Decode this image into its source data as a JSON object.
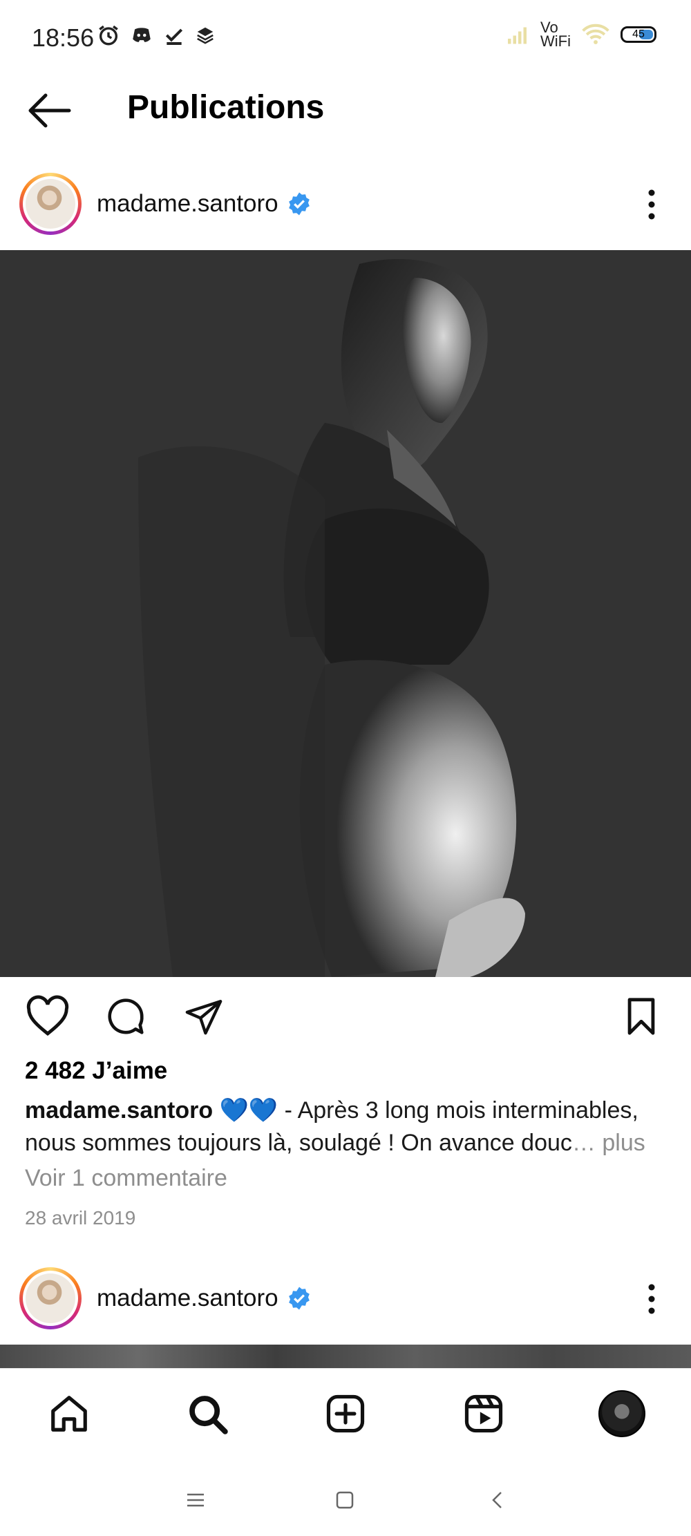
{
  "status_bar": {
    "time": "18:56",
    "icons": [
      "alarm-icon",
      "discord-icon",
      "check-icon",
      "layers-icon"
    ],
    "right_icons": [
      "signal-icon",
      "wifi-icon",
      "battery-icon"
    ],
    "vowifi_top": "Vo",
    "vowifi_bottom": "WiFi",
    "battery": "45"
  },
  "header": {
    "title": "Publications"
  },
  "post": {
    "username": "madame.santoro",
    "verified": true,
    "likes": "2 482 J’aime",
    "caption_user": "madame.santoro",
    "caption_emoji": "💙💙",
    "caption_text": "- Après 3 long mois interminables, nous sommes toujours là, soulagé ! On avance douc",
    "caption_ellipsis": "…",
    "caption_more": "plus",
    "view_comments": "Voir 1 commentaire",
    "date": "28 avril 2019"
  },
  "next_post": {
    "username": "madame.santoro",
    "verified": true
  },
  "bottom_nav": [
    "home-icon",
    "search-icon",
    "create-icon",
    "reels-icon",
    "profile-icon"
  ],
  "colors": {
    "verified_blue": "#3897f0",
    "photo_bg": "#333333",
    "muted_text": "#8e8e8e"
  }
}
